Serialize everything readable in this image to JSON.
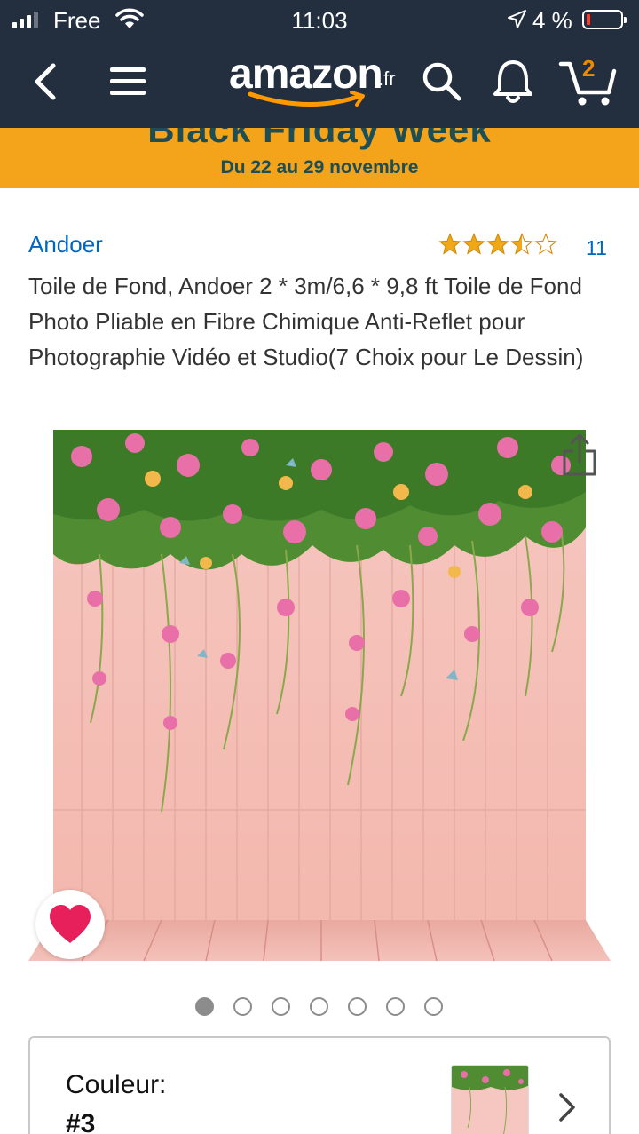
{
  "status_bar": {
    "carrier": "Free",
    "time": "11:03",
    "battery": "4 %",
    "icons": [
      "signal-icon",
      "wifi-icon",
      "location-icon",
      "battery-icon"
    ]
  },
  "nav": {
    "logo_text": "amazon",
    "logo_tld": ".fr",
    "cart_count": "2",
    "icons": [
      "back-icon",
      "menu-icon",
      "search-icon",
      "bell-icon",
      "cart-icon"
    ]
  },
  "banner": {
    "title": "Black Friday Week",
    "subtitle": "Du 22 au 29 novembre"
  },
  "product": {
    "brand": "Andoer",
    "rating": 3.5,
    "rating_max": 5,
    "review_count": "11",
    "title": "Toile de Fond, Andoer 2 * 3m/6,6 * 9,8 ft Toile de Fond Photo Pliable en Fibre Chimique Anti-Reflet pour Photographie Vidéo et Studio(7 Choix pour Le Dessin)"
  },
  "gallery": {
    "image_count": 7,
    "active_index": 0
  },
  "variation": {
    "label": "Couleur:",
    "value": "#3"
  },
  "colors": {
    "header": "#232f3e",
    "banner": "#f3a41a",
    "banner_text": "#1e4e55",
    "link": "#0066c0",
    "star": "#f0a818",
    "heart": "#e7205c"
  }
}
